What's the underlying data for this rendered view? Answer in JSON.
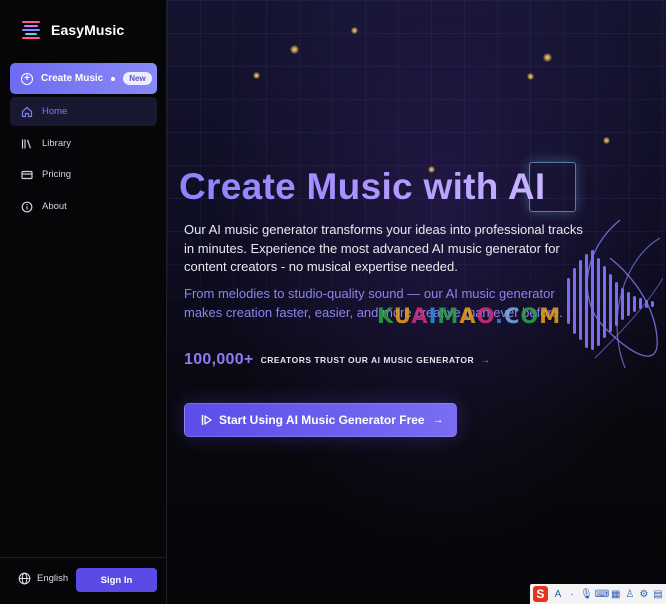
{
  "app": {
    "name": "EasyMusic"
  },
  "sidebar": {
    "create": {
      "label": "Create Music",
      "badge": "New"
    },
    "items": [
      {
        "label": "Home",
        "icon": "home-icon",
        "active": true
      },
      {
        "label": "Library",
        "icon": "library-icon"
      },
      {
        "label": "Pricing",
        "icon": "credit-card-icon"
      },
      {
        "label": "About",
        "icon": "info-icon"
      }
    ],
    "footer": {
      "language": "English",
      "signin": "Sign In"
    }
  },
  "hero": {
    "headline": "Create Music with AI",
    "paragraph1": "Our AI music generator transforms your ideas into professional tracks in minutes. Experience the most advanced AI music generator for content creators - no musical expertise needed.",
    "paragraph2": "From melodies to studio-quality sound — our AI music generator makes creation faster, easier, and more creative than ever before.",
    "stat_number": "100,000+",
    "stat_label": "CREATORS TRUST OUR AI MUSIC GENERATOR",
    "cta": "Start Using AI Music Generator Free"
  },
  "watermark": {
    "text": "KUAIMAO.COM"
  },
  "tray": {
    "items": [
      "S",
      "A",
      "·",
      "mic",
      "kbd",
      "grid",
      "shirt",
      "gear",
      "apps"
    ]
  },
  "colors": {
    "accent": "#6d6bf0",
    "background": "#09090f",
    "cta": "#5b4de8",
    "headline_gradient": "#8c82ff"
  }
}
